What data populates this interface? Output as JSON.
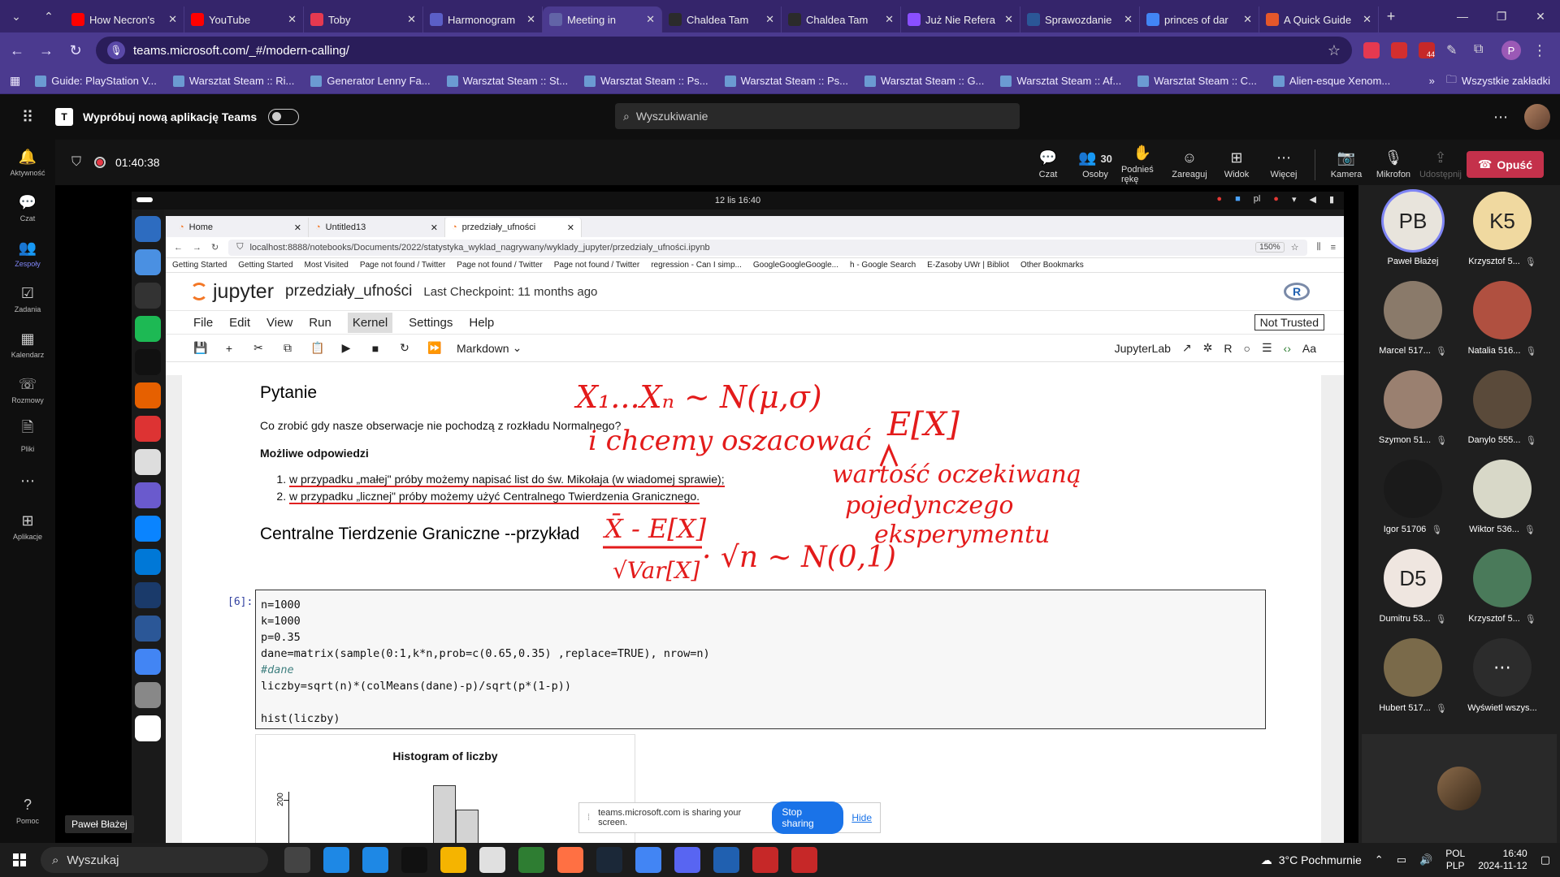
{
  "browser": {
    "tabs": [
      {
        "label": "How Necron's",
        "color": "#ff0000"
      },
      {
        "label": "YouTube",
        "color": "#ff0000"
      },
      {
        "label": "Toby",
        "color": "#e53950"
      },
      {
        "label": "Harmonogram",
        "color": "#5b5fc7"
      },
      {
        "label": "Meeting in",
        "color": "#6264a7",
        "active": true
      },
      {
        "label": "Chaldea Tam",
        "color": "#2b2b2b"
      },
      {
        "label": "Chaldea Tam",
        "color": "#2b2b2b"
      },
      {
        "label": "Już Nie Refera",
        "color": "#8a4fff"
      },
      {
        "label": "Sprawozdanie",
        "color": "#2b5797"
      },
      {
        "label": "princes of dar",
        "color": "#4285f4"
      },
      {
        "label": "A Quick Guide",
        "color": "#e5572a"
      }
    ],
    "url": "teams.microsoft.com/_#/modern-calling/",
    "extension_badge": "44",
    "profile_initial": "P",
    "bookmarks": [
      "Guide: PlayStation V...",
      "Warsztat Steam :: Ri...",
      "Generator Lenny Fa...",
      "Warsztat Steam :: St...",
      "Warsztat Steam :: Ps...",
      "Warsztat Steam :: Ps...",
      "Warsztat Steam :: G...",
      "Warsztat Steam :: Af...",
      "Warsztat Steam :: C...",
      "Alien-esque Xenom..."
    ],
    "all_bookmarks": "Wszystkie zakładki"
  },
  "teams": {
    "try_new": "Wypróbuj nową aplikację Teams",
    "search_placeholder": "Wyszukiwanie",
    "rail": [
      {
        "label": "Aktywność",
        "icon": "bell-icon"
      },
      {
        "label": "Czat",
        "icon": "chat-icon"
      },
      {
        "label": "Zespoły",
        "icon": "teams-icon",
        "active": true
      },
      {
        "label": "Zadania",
        "icon": "tasks-icon"
      },
      {
        "label": "Kalendarz",
        "icon": "calendar-icon"
      },
      {
        "label": "Rozmowy",
        "icon": "phone-icon"
      },
      {
        "label": "Pliki",
        "icon": "file-icon"
      },
      {
        "label": "...",
        "icon": "more-icon"
      },
      {
        "label": "Aplikacje",
        "icon": "apps-icon"
      }
    ],
    "help": "Pomoc",
    "timer": "01:40:38",
    "tools": {
      "chat": "Czat",
      "people": "Osoby",
      "people_count": "30",
      "raise": "Podnieś rękę",
      "react": "Zareaguj",
      "view": "Widok",
      "more": "Więcej",
      "camera": "Kamera",
      "mic": "Mikrofon",
      "share": "Udostępnij",
      "leave": "Opuść"
    },
    "tooltip": "Paweł Błażej",
    "participants": [
      {
        "initials": "PB",
        "name": "Paweł Błażej",
        "bg": "#e8e4dc",
        "speaking": true
      },
      {
        "initials": "K5",
        "name": "Krzysztof 5...",
        "bg": "#f0d9a0"
      },
      {
        "initials": "",
        "name": "Marcel 517...",
        "bg": "#8a7a6a"
      },
      {
        "initials": "",
        "name": "Natalia 516...",
        "bg": "#b05040"
      },
      {
        "initials": "",
        "name": "Szymon 51...",
        "bg": "#9a8070"
      },
      {
        "initials": "",
        "name": "Danylo 555...",
        "bg": "#5a4a3a"
      },
      {
        "initials": "",
        "name": "Igor 51706",
        "bg": "#1a1a1a"
      },
      {
        "initials": "",
        "name": "Wiktor 536...",
        "bg": "#d8d8c8"
      },
      {
        "initials": "D5",
        "name": "Dumitru 53...",
        "bg": "#efe6e0"
      },
      {
        "initials": "",
        "name": "Krzysztof 5...",
        "bg": "#4a7a5a"
      },
      {
        "initials": "",
        "name": "Hubert 517...",
        "bg": "#7a6a4a"
      },
      {
        "initials": "",
        "name": "Wyświetl wszys...",
        "bg": "#2c2c2c",
        "more": true
      }
    ]
  },
  "shared": {
    "topbar_date": "12 lis  16:40",
    "topbar_lang": "pl",
    "ff_tabs": [
      "Home",
      "Untitled13",
      "przedziały_ufności"
    ],
    "ff_url": "localhost:8888/notebooks/Documents/2022/statystyka_wyklad_nagrywany/wyklady_jupyter/przedzialy_ufności.ipynb",
    "ff_zoom": "150%",
    "ff_bookmarks": [
      "Getting Started",
      "Getting Started",
      "Most Visited",
      "Page not found / Twitter",
      "Page not found / Twitter",
      "Page not found / Twitter",
      "regression - Can I simp...",
      "GoogleGoogleGoogle...",
      "h - Google Search",
      "E-Zasoby UWr | Bibliot",
      "Other Bookmarks"
    ],
    "jupyter": {
      "brand": "jupyter",
      "notebook": "przedziały_ufności",
      "checkpoint": "Last Checkpoint: 11 months ago",
      "menu": [
        "File",
        "Edit",
        "View",
        "Run",
        "Kernel",
        "Settings",
        "Help"
      ],
      "active_menu": "Kernel",
      "not_trusted": "Not Trusted",
      "cell_type": "Markdown",
      "jupyterlab": "JupyterLab",
      "kernel_letter": "R",
      "h_question": "Pytanie",
      "question": "Co zrobić gdy nasze obserwacje nie pochodzą z rozkładu Normalnego?",
      "answers_title": "Możliwe odpowiedzi",
      "answer1": "w przypadku „małej\" próby możemy napisać list do św. Mikołaja (w wiadomej sprawie);",
      "answer2": "w przypadku „licznej\" próby możemy użyć Centralnego Twierdzenia Granicznego.",
      "h_clt": "Centralne Tierdzenie Graniczne --przykład",
      "prompt": "[6]:",
      "code": [
        "n=1000",
        "k=1000",
        "p=0.35",
        "dane=matrix(sample(0:1,k*n,prob=c(0.65,0.35) ,replace=TRUE), nrow=n)",
        "#dane",
        "liczby=sqrt(n)*(colMeans(dane)-p)/sqrt(p*(1-p))",
        "",
        "hist(liczby)"
      ],
      "hist_title": "Histogram of liczby",
      "hist_ytick": "200"
    },
    "annotations": {
      "line1": "X₁...Xₙ ∼ N(μ,σ)",
      "line2": "i chcemy oszacować",
      "ex": "E[X]",
      "line3": "wartość oczekiwaną",
      "line4": "pojedynczego",
      "line5": "eksperymentu",
      "formula_num": "X̄ - E[X]",
      "formula_den": "√Var[X]",
      "formula_tail": "· √n ∼ N(0,1)"
    },
    "share_msg": "teams.microsoft.com is sharing your screen.",
    "stop_sharing": "Stop sharing",
    "hide": "Hide"
  },
  "taskbar": {
    "search": "Wyszukaj",
    "weather": "3°C  Pochmurnie",
    "lang1": "POL",
    "lang2": "PLP",
    "time": "16:40",
    "date": "2024-11-12"
  }
}
